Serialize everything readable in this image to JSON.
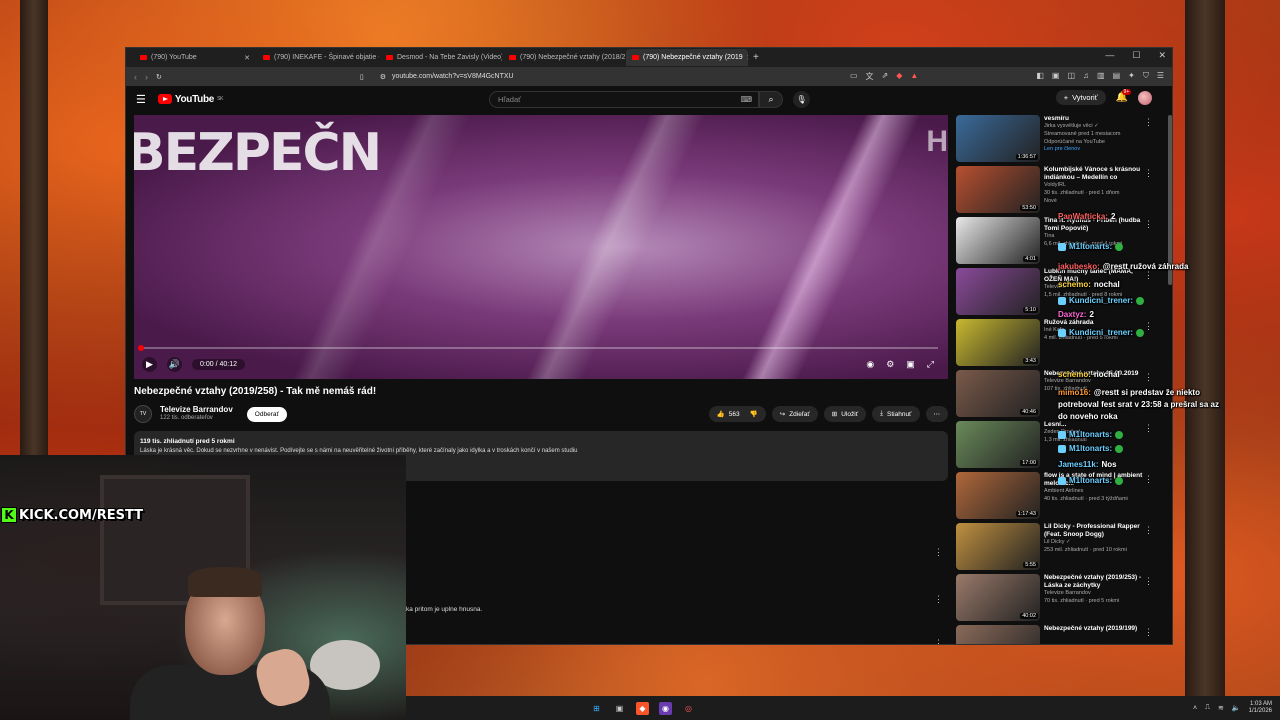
{
  "browser": {
    "tabs": [
      {
        "title": "(790) YouTube",
        "active": false
      },
      {
        "title": "(790) INEKAFE - Špinavé objatie - Yo",
        "active": false
      },
      {
        "title": "Desmod - Na Tebe Zavisly (Video) - Y",
        "active": false
      },
      {
        "title": "(790) Nebezpečné vztahy (2018/237",
        "active": false
      },
      {
        "title": "(790) Nebezpečné vztahy (2019",
        "active": true
      }
    ],
    "new_tab": "+",
    "window_controls": [
      "—",
      "☐",
      "✕"
    ],
    "url": "youtube.com/watch?v=sV8M4GcNTXU"
  },
  "youtube": {
    "logo_text": "YouTube",
    "logo_region": "SK",
    "search_placeholder": "Hľadať",
    "create_label": "Vytvoriť",
    "bell_badge": "9+"
  },
  "player": {
    "overlay_text": "BEZPEČN",
    "right_text": "H",
    "time": "0:00 / 40:12",
    "progress": 0.0
  },
  "video": {
    "title": "Nebezpečné vztahy (2019/258) - Tak mě nemáš rád!",
    "channel_name": "Televize Barrandov",
    "channel_avatar": "TV",
    "subscribers": "122 tis. odberateľov",
    "subscribe_label": "Odberať",
    "likes": "563",
    "share_label": "Zdieľať",
    "save_label": "Uložiť",
    "download_label": "Stiahnuť",
    "description_stats": "119 tis. zhliadnutí  pred 5 rokmi",
    "description_body": "Láska je krásná věc. Dokud se nezvrhne v nenávist. Podívejte se s námi na neuvěřitelné životní příběhy, které začínaly jako idylka a v troskách končí v našem studiu",
    "comment_fragment": "ka pritom je uplne hnusna."
  },
  "recommendations": [
    {
      "title": "vesmíru",
      "channel": "Jirka vysvětluje věci ✓",
      "meta": "Streamované pred 1 mesiacom",
      "extra": "Odporúčané na YouTube",
      "badge": "Len pre členov",
      "duration": "1:36:57",
      "color": "#3a6a9a"
    },
    {
      "title": "Kolumbijské Vánoce s krásnou indiánkou – Medellín co",
      "channel": "VoldyIRL",
      "meta": "30 tis. zhliadnutí · pred 1 dňom",
      "extra": "Nové",
      "badge": "",
      "duration": "53:50",
      "color": "#b85030"
    },
    {
      "title": "Tina ft. Rytmus - Príbeh (hudba Tomi Popovič)",
      "channel": "Tina",
      "meta": "6,6 mil. zhliadnutí · pred 4 rokmi",
      "extra": "",
      "badge": "",
      "duration": "4:01",
      "color": "#e8e8e8"
    },
    {
      "title": "Lubkin mučný tanec (MAMA, OŽEŇ MA!)",
      "channel": "Televízia",
      "meta": "1,5 mil. zhliadnutí · pred 8 rokmi",
      "extra": "",
      "badge": "",
      "duration": "5:10",
      "color": "#8a4a9a"
    },
    {
      "title": "Ružová záhrada",
      "channel": "Iné Kafe",
      "meta": "4 mil. zhliadnutí · pred 5 rokmi",
      "extra": "",
      "badge": "",
      "duration": "3:43",
      "color": "#c8b830"
    },
    {
      "title": "Nebezpečné vztahy 16.09.2019",
      "channel": "Televize Barrandov",
      "meta": "107 tis. zhliadnutí",
      "extra": "",
      "badge": "",
      "duration": "40:46",
      "color": "#7a5a4a"
    },
    {
      "title": "Lesní...",
      "channel": "Zeden Product",
      "meta": "1,3 mil. zhliadnutí",
      "extra": "",
      "badge": "",
      "duration": "17:00",
      "color": "#6a8a5a"
    },
    {
      "title": "flow is a state of mind | ambient melodic...",
      "channel": "Ambient Airlines",
      "meta": "40 tis. zhliadnutí · pred 3 týždňami",
      "extra": "",
      "badge": "",
      "duration": "1:17:43",
      "color": "#b0683a"
    },
    {
      "title": "Lil Dicky - Professional Rapper (Feat. Snoop Dogg)",
      "channel": "Lil Dicky ✓",
      "meta": "253 mil. zhliadnutí · pred 10 rokmi",
      "extra": "",
      "badge": "",
      "duration": "5:55",
      "color": "#c09040"
    },
    {
      "title": "Nebezpečné vztahy (2019/253) - Láska ze záchytky",
      "channel": "Televize Barrandov",
      "meta": "70 tis. zhliadnutí · pred 5 rokmi",
      "extra": "",
      "badge": "",
      "duration": "40:02",
      "color": "#9a7a6a"
    },
    {
      "title": "Nebezpečné vztahy (2019/199)",
      "channel": "",
      "meta": "",
      "extra": "",
      "badge": "",
      "duration": "",
      "color": "#8a6a5a"
    }
  ],
  "chat": [
    {
      "name": "PanWafticka:",
      "text": "2",
      "color": "name-r",
      "em": false
    },
    {
      "name": "M1ltonarts:",
      "text": "",
      "color": "name-g",
      "em": true
    },
    {
      "name": "jakubesko:",
      "text": "@restt ružová záhrada",
      "color": "name-r",
      "em": false
    },
    {
      "name": "schemo:",
      "text": "nochal",
      "color": "name-y",
      "em": false
    },
    {
      "name": "Kundicni_trener:",
      "text": "",
      "color": "name-g",
      "em": true
    },
    {
      "name": "Daxtyz:",
      "text": "2",
      "color": "name-p",
      "em": false
    },
    {
      "name": "Kundicni_trener:",
      "text": "",
      "color": "name-g",
      "em": true
    },
    {
      "name": "schemo:",
      "text": "nochal",
      "color": "name-y",
      "em": false
    },
    {
      "name": "mimo16:",
      "text": "@restt si predstav že niekto",
      "color": "name-o",
      "em": false
    },
    {
      "name": "",
      "text": "potreboval fest srat v 23:58 a prešral sa az",
      "color": "",
      "em": false
    },
    {
      "name": "",
      "text": "do noveho roka",
      "color": "",
      "em": false
    },
    {
      "name": "M1ltonarts:",
      "text": "",
      "color": "name-g",
      "em": true
    },
    {
      "name": "M1ltonarts:",
      "text": "",
      "color": "name-g",
      "em": true
    },
    {
      "name": "James11k:",
      "text": "Nos",
      "color": "name-g",
      "em": false
    },
    {
      "name": "M1ltonarts:",
      "text": "",
      "color": "name-g",
      "em": true
    }
  ],
  "stream": {
    "kick_label": "KICK.COM/RESTT",
    "kick_letter": "K"
  },
  "taskbar": {
    "time": "1:03 AM",
    "date": "1/1/2026"
  }
}
